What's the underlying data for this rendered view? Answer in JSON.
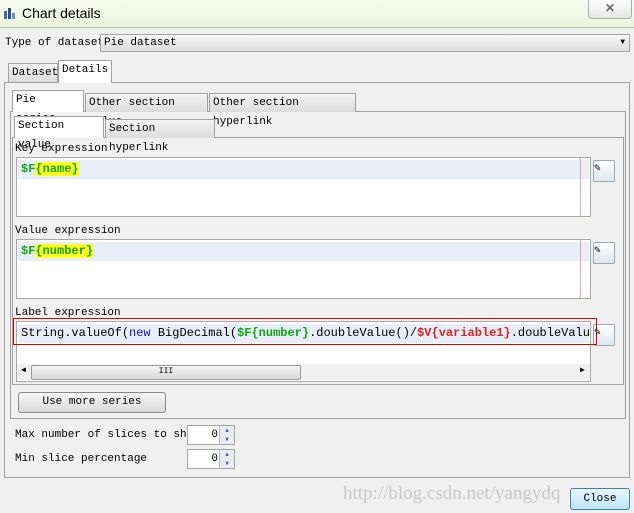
{
  "window": {
    "title": "Chart details",
    "close_icon": "close-x-icon"
  },
  "dataset_type": {
    "label": "Type of dataset",
    "value": "Pie dataset"
  },
  "outer_tabs": [
    {
      "label": "Dataset"
    },
    {
      "label": "Details",
      "selected": true
    }
  ],
  "inner_tabs": [
    {
      "label": "Pie series",
      "selected": true
    },
    {
      "label": "Other section value"
    },
    {
      "label": "Other section hyperlink"
    }
  ],
  "sub_tabs": [
    {
      "label": "Section value",
      "selected": true
    },
    {
      "label": "Section hyperlink"
    }
  ],
  "key_expression": {
    "label": "Key expression",
    "prefix": "$F",
    "field": "{name}"
  },
  "value_expression": {
    "label": "Value expression",
    "prefix": "$F",
    "field": "{number}"
  },
  "label_expression": {
    "label": "Label expression",
    "p1": "String.valueOf(",
    "kw": "new",
    "p2": " BigDecimal(",
    "f_prefix": "$F",
    "f_field": "{number}",
    "p3": ".doubleValue()/",
    "v_prefix": "$V",
    "v_field": "{variable1}",
    "p4": ".doubleValu"
  },
  "use_more_series": "Use more series",
  "max_slices": {
    "label": "Max number of slices to show",
    "value": "0"
  },
  "min_slice_pct": {
    "label": "Min slice percentage",
    "value": "0"
  },
  "close_button": "Close",
  "watermark": "http://blog.csdn.net/yangydq",
  "colors": {
    "highlight_box": "#e00000",
    "field": "#11a711",
    "variable": "#e21f1f",
    "keyword": "#1010d0"
  }
}
